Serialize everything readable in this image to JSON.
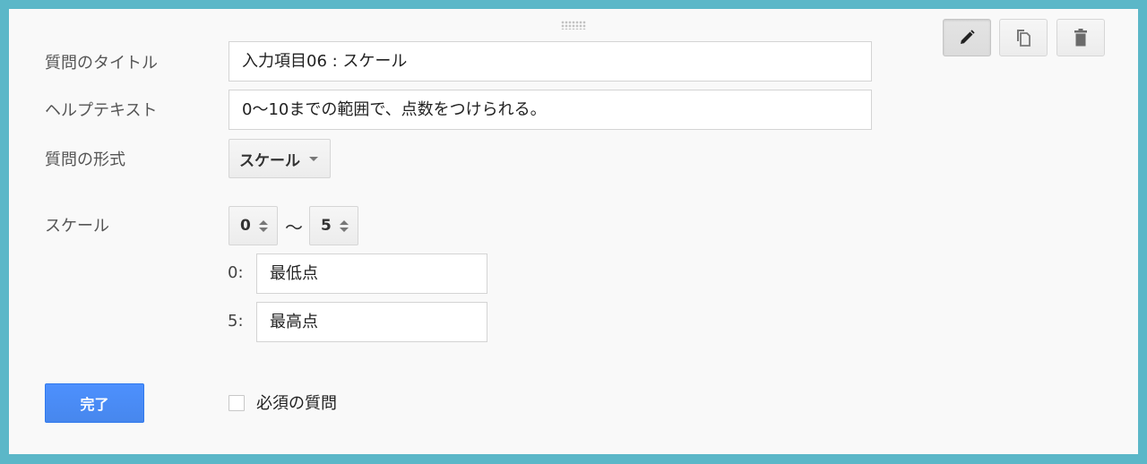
{
  "toolbar": {
    "edit_icon": "pencil-icon",
    "duplicate_icon": "duplicate-icon",
    "delete_icon": "trash-icon"
  },
  "form": {
    "title_label": "質問のタイトル",
    "title_value": "入力項目06 : スケール",
    "help_label": "ヘルプテキスト",
    "help_value": "0〜10までの範囲で、点数をつけられる。",
    "type_label": "質問の形式",
    "type_value": "スケール",
    "scale_label": "スケール",
    "scale_min": "0",
    "scale_separator": "〜",
    "scale_max": "5",
    "min_prefix": "0:",
    "min_label_value": "最低点",
    "max_prefix": "5:",
    "max_label_value": "最高点",
    "done_label": "完了",
    "required_label": "必須の質問"
  },
  "colors": {
    "background": "#5bb7c8",
    "panel": "#f9f9f9",
    "primary_button": "#4d90fe"
  }
}
